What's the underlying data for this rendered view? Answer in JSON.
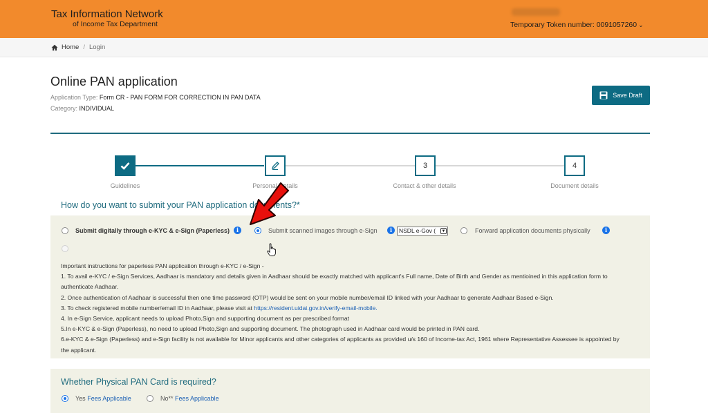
{
  "header": {
    "brand_line1": "Tax Information Network",
    "brand_line2": "of Income Tax Department",
    "token_label": "Temporary Token number: 0091057260",
    "chevron": "⌄"
  },
  "breadcrumb": {
    "home": "Home",
    "separator": "/",
    "current": "Login"
  },
  "page": {
    "title": "Online PAN application",
    "application_type_label": "Application Type: ",
    "application_type_value": "Form CR - PAN FORM FOR CORRECTION IN PAN DATA",
    "category_label": "Category: ",
    "category_value": "INDIVIDUAL",
    "save_draft": "Save Draft"
  },
  "stepper": {
    "steps": [
      {
        "label": "Guidelines",
        "number": ""
      },
      {
        "label": "Personal Details",
        "number": ""
      },
      {
        "label": "Contact & other details",
        "number": "3"
      },
      {
        "label": "Document details",
        "number": "4"
      }
    ]
  },
  "submission": {
    "question": "How do you want to submit your PAN application documents?*",
    "options": [
      {
        "label": "Submit digitally through e-KYC & e-Sign (Paperless)",
        "selected": false
      },
      {
        "label": "Submit scanned images through e-Sign",
        "selected": true
      },
      {
        "label": "Forward application documents physically",
        "selected": false
      }
    ],
    "esign_provider": "NSDL e-Gov (",
    "info_glyph": "i",
    "instructions_title": "Important instructions for paperless PAN application through e-KYC / e-Sign -",
    "instructions": [
      "1. To avail e-KYC / e-Sign Services, Aadhaar is mandatory and details given in Aadhaar should be exactly matched with applicant's Full name, Date of Birth and Gender as mentioined in this application form to authenticate Aadhaar.",
      "2. Once authentication of Aadhaar is successful then one time password (OTP) would be sent on your mobile number/email ID linked with your Aadhaar to generate Aadhaar Based e-Sign.",
      "3. To check registered mobile number/email ID in Aadhaar, please visit at ",
      "4. In e-Sign Service, applicant needs to upload Photo,Sign and supporting document as per prescribed format",
      "5.In e-KYC & e-Sign (Paperless), no need to upload Photo,Sign and supporting document. The photograph used in Aadhaar card would be printed in PAN card.",
      "6.e-KYC & e-Sign (Paperless) and e-Sign facility is not available for Minor applicants and other categories of applicants as provided u/s 160 of Income-tax Act, 1961 where Representative Assessee is appointed by the applicant."
    ],
    "instructions_link": "https://resident.uidai.gov.in/verify-email-mobile."
  },
  "physical_card": {
    "question": "Whether Physical PAN Card is required?",
    "yes_label": "Yes",
    "yes_fee": "Fees Applicable",
    "no_label": "No**",
    "no_fee": "Fees Applicable",
    "selected": "yes"
  },
  "colors": {
    "header_orange": "#f28a2c",
    "teal": "#0d6b83",
    "panel_bg": "#f1f1e6",
    "arrow_red": "#e8100c"
  }
}
